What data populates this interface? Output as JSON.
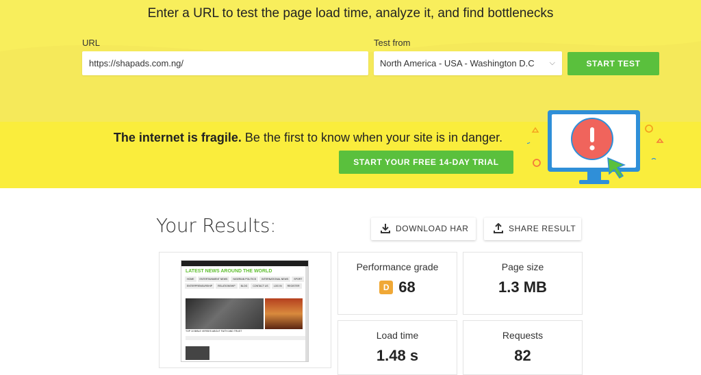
{
  "hero": {
    "title": "Enter a URL to test the page load time, analyze it, and find bottlenecks",
    "url_label": "URL",
    "url_value": "https://shapads.com.ng/",
    "test_from_label": "Test from",
    "test_from_value": "North America - USA - Washington D.C",
    "start_test_label": "START TEST"
  },
  "promo": {
    "bold": "The internet is fragile.",
    "text": " Be the first to know when your site is in danger.",
    "trial_label": "START YOUR FREE 14-DAY TRIAL"
  },
  "results": {
    "title": "Your Results:",
    "download_har_label": "DOWNLOAD HAR",
    "share_result_label": "SHARE RESULT",
    "performance_grade_label": "Performance grade",
    "performance_grade_letter": "D",
    "performance_grade_score": "68",
    "page_size_label": "Page size",
    "page_size_value": "1.3 MB",
    "load_time_label": "Load time",
    "load_time_value": "1.48 s",
    "requests_label": "Requests",
    "requests_value": "82"
  },
  "thumbnail": {
    "headline": "LATEST NEWS AROUND THE WORLD",
    "nav": [
      "HOME",
      "ENTERTAINMENT NEWS",
      "NIGERIAN POLITICS",
      "INTERNATIONAL NEWS",
      "SPORT",
      "ENTERPRENEURSHIP",
      "RELATIONSHIP",
      "BLOG",
      "CONTACT US",
      "LOG IN",
      "REGISTER"
    ],
    "caption": "TOP 10 BIBLE VERSES ABOUT FAITH AND TRUST"
  },
  "colors": {
    "hero_bg": "#f8ee5c",
    "promo_bg": "#faed3c",
    "accent_green": "#5ac03d",
    "grade_d": "#f0a836",
    "monitor_blue": "#2f8fd8",
    "alert_red": "#f0645c"
  },
  "icons": {
    "select_chevron": "chevron-down-icon",
    "download": "download-icon",
    "share": "share-icon",
    "monitor": "monitor-alert-illustration"
  }
}
